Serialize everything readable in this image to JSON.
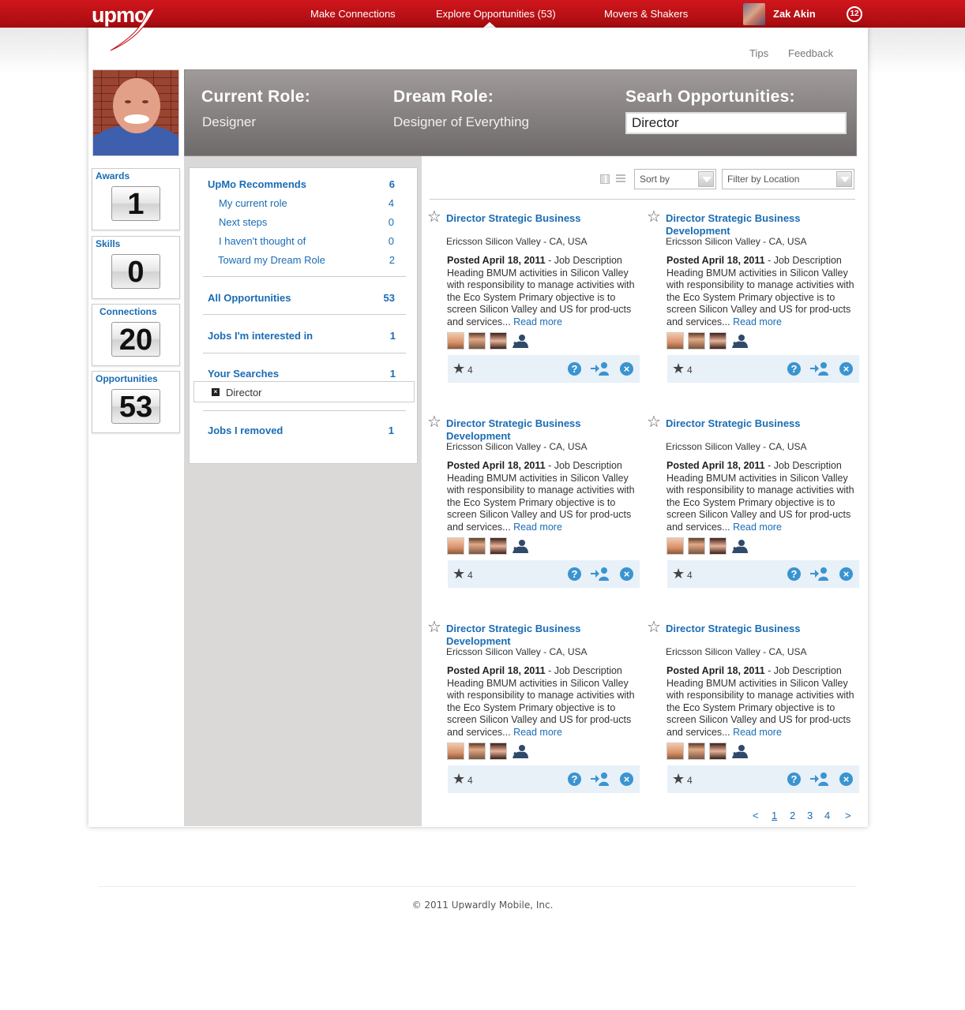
{
  "brand": {
    "logo_text": "upmo"
  },
  "nav": {
    "items": [
      "Make Connections",
      "Explore Opportunities (53)",
      "Movers & Shakers"
    ],
    "user_name": "Zak Akin",
    "notification_count": "12"
  },
  "util_links": {
    "tips": "Tips",
    "feedback": "Feedback"
  },
  "roles": {
    "current_label": "Current Role:",
    "current_value": "Designer",
    "dream_label": "Dream Role:",
    "dream_value": "Designer of Everything",
    "search_label": "Searh Opportunities:",
    "search_value": "Director"
  },
  "stats": [
    {
      "label": "Awards",
      "value": "1"
    },
    {
      "label": "Skills",
      "value": "0"
    },
    {
      "label": "Connections",
      "value": "20"
    },
    {
      "label": "Opportunities",
      "value": "53"
    }
  ],
  "filters": {
    "recommends": {
      "label": "UpMo Recommends",
      "count": "6"
    },
    "sub": [
      {
        "label": "My current role",
        "count": "4"
      },
      {
        "label": "Next steps",
        "count": "0"
      },
      {
        "label": "I haven't thought of",
        "count": "0"
      },
      {
        "label": "Toward my Dream Role",
        "count": "2"
      }
    ],
    "all": {
      "label": "All Opportunities",
      "count": "53"
    },
    "interested": {
      "label": "Jobs I'm interested in",
      "count": "1"
    },
    "searches": {
      "label": "Your Searches",
      "count": "1"
    },
    "search_tag": "Director",
    "removed": {
      "label": "Jobs I removed",
      "count": "1"
    }
  },
  "toolbar": {
    "sort_label": "Sort by",
    "filter_label": "Filter by Location"
  },
  "cards": [
    {
      "title": "Director Strategic Business",
      "location": "Ericsson Silicon Valley - CA, USA",
      "posted": "Posted April 18, 2011",
      "desc": " - Job Description Heading BMUM activities in Silicon Valley with responsibility to manage activities with the Eco System Primary objective is to screen Silicon Valley and US for prod-ucts and services... ",
      "read_more": "Read more",
      "rating": "4"
    },
    {
      "title": "Director Strategic Business Development",
      "location": "Ericsson Silicon Valley - CA, USA",
      "posted": "Posted April 18, 2011",
      "desc": " - Job Description Heading BMUM activities in Silicon Valley with responsibility to manage activities with the Eco System Primary objective is to screen Silicon Valley and US for prod-ucts and services... ",
      "read_more": "Read more",
      "rating": "4"
    },
    {
      "title": "Director Strategic Business Development",
      "location": "Ericsson Silicon Valley - CA, USA",
      "posted": "Posted April 18, 2011",
      "desc": " - Job Description Heading BMUM activities in Silicon Valley with responsibility to manage activities with the Eco System Primary objective is to screen Silicon Valley and US for prod-ucts and services... ",
      "read_more": "Read more",
      "rating": "4"
    },
    {
      "title": "Director Strategic Business",
      "location": "Ericsson Silicon Valley - CA, USA",
      "posted": "Posted April 18, 2011",
      "desc": " - Job Description Heading BMUM activities in Silicon Valley with responsibility to manage activities with the Eco System Primary objective is to screen Silicon Valley and US for prod-ucts and services... ",
      "read_more": "Read more",
      "rating": "4"
    },
    {
      "title": "Director Strategic Business Development",
      "location": "Ericsson Silicon Valley - CA, USA",
      "posted": "Posted April 18, 2011",
      "desc": " - Job Description Heading BMUM activities in Silicon Valley with responsibility to manage activities with the Eco System Primary objective is to screen Silicon Valley and US for prod-ucts and services... ",
      "read_more": "Read more",
      "rating": "4"
    },
    {
      "title": "Director Strategic Business",
      "location": "Ericsson Silicon Valley - CA, USA",
      "posted": "Posted April 18, 2011",
      "desc": " - Job Description Heading BMUM activities in Silicon Valley with responsibility to manage activities with the Eco System Primary objective is to screen Silicon Valley and US for prod-ucts and services... ",
      "read_more": "Read more",
      "rating": "4"
    }
  ],
  "pager": {
    "prev": "<",
    "pages": [
      "1",
      "2",
      "3",
      "4"
    ],
    "next": ">"
  },
  "footer": "© 2011 Upwardly Mobile, Inc.",
  "colors": {
    "brand_red": "#c4121a",
    "link_blue": "#1a6cb4",
    "action_blue": "#3a94d0"
  },
  "icons": {
    "favorite": "star-outline-icon",
    "rating": "star-icon",
    "ask": "question-bubble-icon",
    "refer": "add-person-icon",
    "remove": "close-circle-icon",
    "grid_view": "grid-view-icon",
    "list_view": "list-view-icon"
  }
}
